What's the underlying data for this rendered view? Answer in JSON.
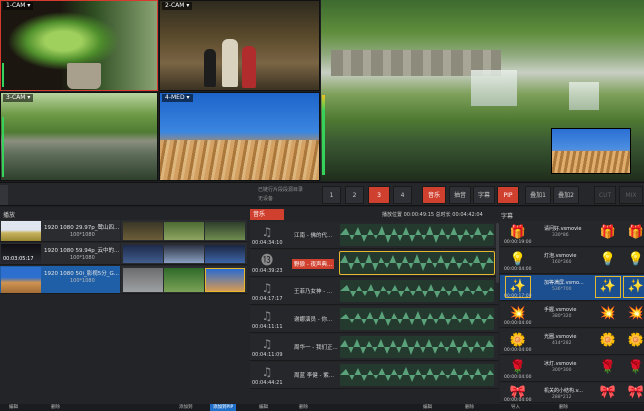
{
  "cameras": [
    {
      "label": "1-CAM ▾"
    },
    {
      "label": "2-CAM ▾"
    },
    {
      "label": "3-CAM ▾"
    },
    {
      "label": "4-MED ▾"
    }
  ],
  "strip": {
    "info_line1": "已链行片段段源目录",
    "info_line2": "无设备",
    "buttons": [
      "1",
      "2",
      "3",
      "4",
      "音乐",
      "抽音",
      "字幕",
      "PIP",
      "叠加1",
      "叠加2",
      "CUT",
      "MIX"
    ],
    "active_scene": "3"
  },
  "clips_panel": {
    "title": "播放",
    "clips": [
      {
        "title": "1920 1080 29.97p_鹭山四...",
        "sub": "100*1080",
        "dur": ""
      },
      {
        "title": "1920 1080 59.94p_云中的...",
        "sub": "100*1080",
        "dur": "00:03:05:17"
      },
      {
        "title": "1920 1080 50i_影视5分_G...",
        "sub": "100*1080",
        "dur": ""
      }
    ]
  },
  "music_panel": {
    "tab": "音乐",
    "time_info": "播放位置 00:00:49:15    总时长 00:04:42:04",
    "tracks": [
      {
        "time": "00:04:34:10",
        "name": "江南 - 佛的代..."
      },
      {
        "time": "00:04:39:23",
        "name": "野狼 - 夜声典..."
      },
      {
        "time": "00:04:17:17",
        "name": "王菲乃女神 - ..."
      },
      {
        "time": "00:04:11:11",
        "name": "谢娜演员 - 你..."
      },
      {
        "time": "00:04:11:09",
        "name": "周华一 - 我们正..."
      },
      {
        "time": "00:04:44:21",
        "name": "周蓝 李健 - 紫..."
      }
    ]
  },
  "effects_panel": {
    "title": "字幕",
    "items": [
      {
        "time": "00:00:19:00",
        "name": "请问好.vsmovie",
        "size": "330*86",
        "glyph": "🎁"
      },
      {
        "time": "00:00:04:00",
        "name": "灯泡.vsmovie",
        "size": "160*360",
        "glyph": "💡"
      },
      {
        "time": "00:00:17:09",
        "name": "加等满屏.vsmo...",
        "size": "536*700",
        "glyph": "✨"
      },
      {
        "time": "00:00:04:00",
        "name": "手握.vsmovie",
        "size": "380*320",
        "glyph": "💥"
      },
      {
        "time": "00:00:04:00",
        "name": "光圈.vsmovie",
        "size": "414*282",
        "glyph": "🌼"
      },
      {
        "time": "00:00:04:00",
        "name": "冰灯.vsmovie",
        "size": "300*300",
        "glyph": "🌹"
      },
      {
        "time": "00:00:04:00",
        "name": "机关的小结构.v...",
        "size": "288*212",
        "glyph": "🎀"
      }
    ]
  },
  "bottom_bar": [
    "编辑",
    "删除",
    "添加到",
    "添加到PIP",
    "编辑",
    "删除",
    "编辑",
    "删除",
    "导入",
    "删除"
  ],
  "colors": {
    "accent": "#d0402f",
    "select_blue": "#1f5fa8",
    "waveform": "#5aa27a",
    "meter": "#35d15b"
  }
}
